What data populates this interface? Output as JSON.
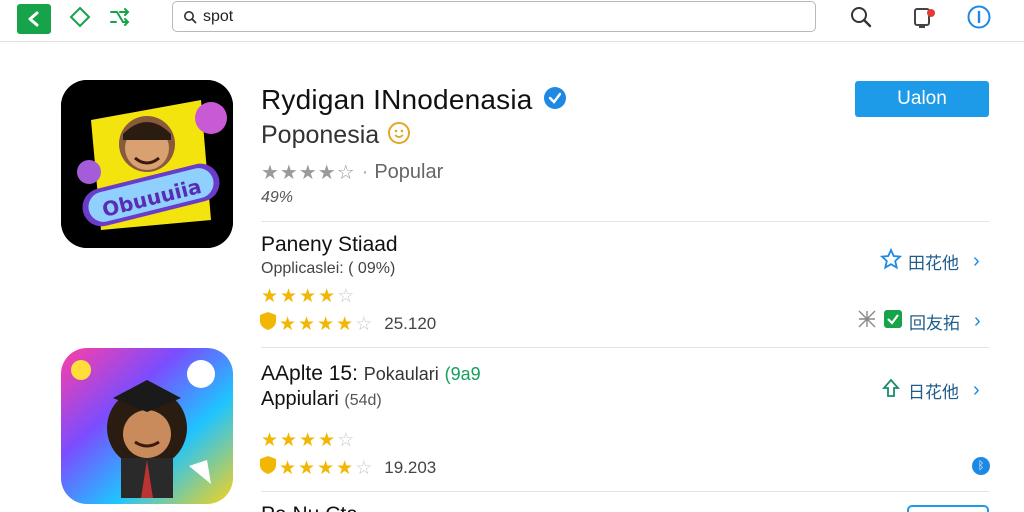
{
  "search": {
    "value": "spot"
  },
  "hero": {
    "title": "Rydigan INnodenasia",
    "subtitle": "Poponesia",
    "rating_stars": "★★★★☆",
    "rating_label": "Popular",
    "percent": "49%",
    "install_label": "Ualon",
    "icon_text": "Obuuuiia"
  },
  "items": [
    {
      "title": "Paneny Stiaad",
      "subtitle": "Opplicaslei: ( 09%)",
      "stars": 4,
      "score": "25.120",
      "action_top": "田花他",
      "action_bottom": "回友拓"
    },
    {
      "title": "AAplte 15: ",
      "title_extra": "Pokaulari",
      "title_tag": "(9a9",
      "subtitle_line1": "Appiulari",
      "subtitle_line2": "(54d)",
      "stars": 4,
      "score": "19.203",
      "action_top": "日花他"
    }
  ],
  "peek": {
    "title": "Pa Nu Cta"
  },
  "colors": {
    "accent": "#1e9be8",
    "green": "#16a34a",
    "star": "#f2b705"
  }
}
